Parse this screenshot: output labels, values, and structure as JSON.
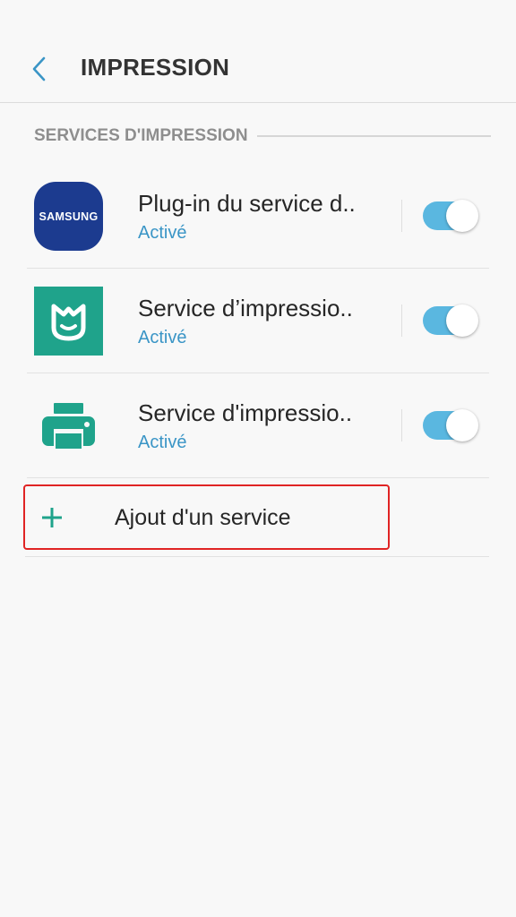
{
  "header": {
    "title": "IMPRESSION",
    "back_icon": "chevron-left-icon"
  },
  "section": {
    "title": "SERVICES D'IMPRESSION"
  },
  "services": [
    {
      "name": "Plug-in du service d..",
      "status": "Activé",
      "icon": "samsung-logo-icon",
      "icon_text": "SAMSUNG",
      "enabled": true
    },
    {
      "name": "Service d’impressio..",
      "status": "Activé",
      "icon": "mi-home-icon",
      "enabled": true
    },
    {
      "name": "Service d'impressio..",
      "status": "Activé",
      "icon": "printer-icon",
      "enabled": true
    }
  ],
  "add_service": {
    "label": "Ajout d'un service",
    "icon": "plus-icon"
  },
  "colors": {
    "accent_blue": "#3a95c6",
    "toggle_on": "#5ab7e0",
    "teal": "#1fa38b",
    "samsung_blue": "#1c3b8f",
    "highlight_red": "#e02424",
    "background": "#f8f8f8"
  }
}
